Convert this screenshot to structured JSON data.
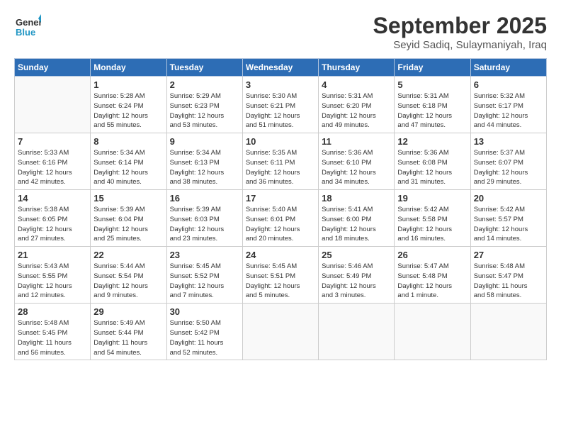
{
  "logo": {
    "line1": "General",
    "line2": "Blue"
  },
  "title": "September 2025",
  "subtitle": "Seyid Sadiq, Sulaymaniyah, Iraq",
  "weekdays": [
    "Sunday",
    "Monday",
    "Tuesday",
    "Wednesday",
    "Thursday",
    "Friday",
    "Saturday"
  ],
  "weeks": [
    [
      {
        "day": "",
        "sunrise": "",
        "sunset": "",
        "daylight": ""
      },
      {
        "day": "1",
        "sunrise": "Sunrise: 5:28 AM",
        "sunset": "Sunset: 6:24 PM",
        "daylight": "Daylight: 12 hours and 55 minutes."
      },
      {
        "day": "2",
        "sunrise": "Sunrise: 5:29 AM",
        "sunset": "Sunset: 6:23 PM",
        "daylight": "Daylight: 12 hours and 53 minutes."
      },
      {
        "day": "3",
        "sunrise": "Sunrise: 5:30 AM",
        "sunset": "Sunset: 6:21 PM",
        "daylight": "Daylight: 12 hours and 51 minutes."
      },
      {
        "day": "4",
        "sunrise": "Sunrise: 5:31 AM",
        "sunset": "Sunset: 6:20 PM",
        "daylight": "Daylight: 12 hours and 49 minutes."
      },
      {
        "day": "5",
        "sunrise": "Sunrise: 5:31 AM",
        "sunset": "Sunset: 6:18 PM",
        "daylight": "Daylight: 12 hours and 47 minutes."
      },
      {
        "day": "6",
        "sunrise": "Sunrise: 5:32 AM",
        "sunset": "Sunset: 6:17 PM",
        "daylight": "Daylight: 12 hours and 44 minutes."
      }
    ],
    [
      {
        "day": "7",
        "sunrise": "Sunrise: 5:33 AM",
        "sunset": "Sunset: 6:16 PM",
        "daylight": "Daylight: 12 hours and 42 minutes."
      },
      {
        "day": "8",
        "sunrise": "Sunrise: 5:34 AM",
        "sunset": "Sunset: 6:14 PM",
        "daylight": "Daylight: 12 hours and 40 minutes."
      },
      {
        "day": "9",
        "sunrise": "Sunrise: 5:34 AM",
        "sunset": "Sunset: 6:13 PM",
        "daylight": "Daylight: 12 hours and 38 minutes."
      },
      {
        "day": "10",
        "sunrise": "Sunrise: 5:35 AM",
        "sunset": "Sunset: 6:11 PM",
        "daylight": "Daylight: 12 hours and 36 minutes."
      },
      {
        "day": "11",
        "sunrise": "Sunrise: 5:36 AM",
        "sunset": "Sunset: 6:10 PM",
        "daylight": "Daylight: 12 hours and 34 minutes."
      },
      {
        "day": "12",
        "sunrise": "Sunrise: 5:36 AM",
        "sunset": "Sunset: 6:08 PM",
        "daylight": "Daylight: 12 hours and 31 minutes."
      },
      {
        "day": "13",
        "sunrise": "Sunrise: 5:37 AM",
        "sunset": "Sunset: 6:07 PM",
        "daylight": "Daylight: 12 hours and 29 minutes."
      }
    ],
    [
      {
        "day": "14",
        "sunrise": "Sunrise: 5:38 AM",
        "sunset": "Sunset: 6:05 PM",
        "daylight": "Daylight: 12 hours and 27 minutes."
      },
      {
        "day": "15",
        "sunrise": "Sunrise: 5:39 AM",
        "sunset": "Sunset: 6:04 PM",
        "daylight": "Daylight: 12 hours and 25 minutes."
      },
      {
        "day": "16",
        "sunrise": "Sunrise: 5:39 AM",
        "sunset": "Sunset: 6:03 PM",
        "daylight": "Daylight: 12 hours and 23 minutes."
      },
      {
        "day": "17",
        "sunrise": "Sunrise: 5:40 AM",
        "sunset": "Sunset: 6:01 PM",
        "daylight": "Daylight: 12 hours and 20 minutes."
      },
      {
        "day": "18",
        "sunrise": "Sunrise: 5:41 AM",
        "sunset": "Sunset: 6:00 PM",
        "daylight": "Daylight: 12 hours and 18 minutes."
      },
      {
        "day": "19",
        "sunrise": "Sunrise: 5:42 AM",
        "sunset": "Sunset: 5:58 PM",
        "daylight": "Daylight: 12 hours and 16 minutes."
      },
      {
        "day": "20",
        "sunrise": "Sunrise: 5:42 AM",
        "sunset": "Sunset: 5:57 PM",
        "daylight": "Daylight: 12 hours and 14 minutes."
      }
    ],
    [
      {
        "day": "21",
        "sunrise": "Sunrise: 5:43 AM",
        "sunset": "Sunset: 5:55 PM",
        "daylight": "Daylight: 12 hours and 12 minutes."
      },
      {
        "day": "22",
        "sunrise": "Sunrise: 5:44 AM",
        "sunset": "Sunset: 5:54 PM",
        "daylight": "Daylight: 12 hours and 9 minutes."
      },
      {
        "day": "23",
        "sunrise": "Sunrise: 5:45 AM",
        "sunset": "Sunset: 5:52 PM",
        "daylight": "Daylight: 12 hours and 7 minutes."
      },
      {
        "day": "24",
        "sunrise": "Sunrise: 5:45 AM",
        "sunset": "Sunset: 5:51 PM",
        "daylight": "Daylight: 12 hours and 5 minutes."
      },
      {
        "day": "25",
        "sunrise": "Sunrise: 5:46 AM",
        "sunset": "Sunset: 5:49 PM",
        "daylight": "Daylight: 12 hours and 3 minutes."
      },
      {
        "day": "26",
        "sunrise": "Sunrise: 5:47 AM",
        "sunset": "Sunset: 5:48 PM",
        "daylight": "Daylight: 12 hours and 1 minute."
      },
      {
        "day": "27",
        "sunrise": "Sunrise: 5:48 AM",
        "sunset": "Sunset: 5:47 PM",
        "daylight": "Daylight: 11 hours and 58 minutes."
      }
    ],
    [
      {
        "day": "28",
        "sunrise": "Sunrise: 5:48 AM",
        "sunset": "Sunset: 5:45 PM",
        "daylight": "Daylight: 11 hours and 56 minutes."
      },
      {
        "day": "29",
        "sunrise": "Sunrise: 5:49 AM",
        "sunset": "Sunset: 5:44 PM",
        "daylight": "Daylight: 11 hours and 54 minutes."
      },
      {
        "day": "30",
        "sunrise": "Sunrise: 5:50 AM",
        "sunset": "Sunset: 5:42 PM",
        "daylight": "Daylight: 11 hours and 52 minutes."
      },
      {
        "day": "",
        "sunrise": "",
        "sunset": "",
        "daylight": ""
      },
      {
        "day": "",
        "sunrise": "",
        "sunset": "",
        "daylight": ""
      },
      {
        "day": "",
        "sunrise": "",
        "sunset": "",
        "daylight": ""
      },
      {
        "day": "",
        "sunrise": "",
        "sunset": "",
        "daylight": ""
      }
    ]
  ]
}
